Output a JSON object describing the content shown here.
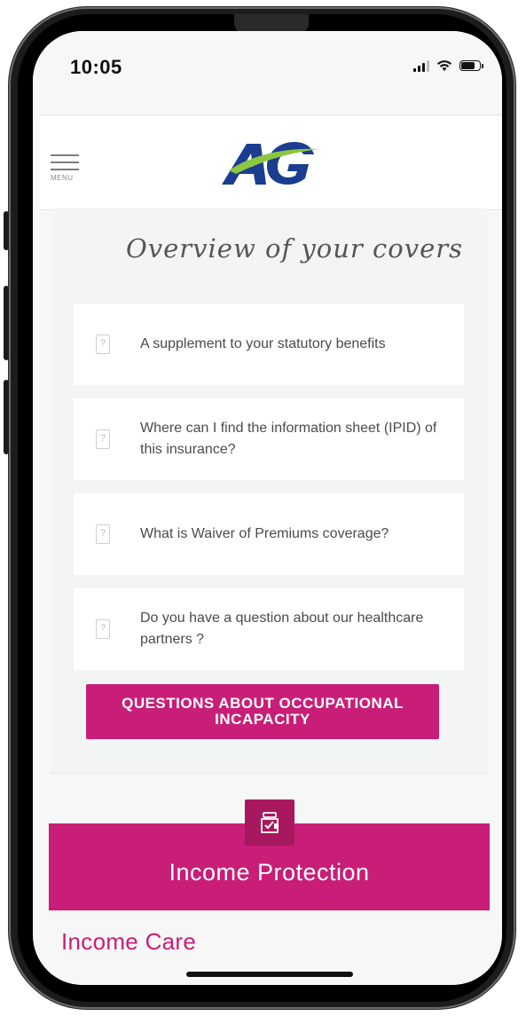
{
  "status_bar": {
    "time": "10:05"
  },
  "header": {
    "menu_label": "MENU",
    "logo_text": "AG"
  },
  "overview": {
    "title": "Overview of your covers"
  },
  "faq_items": [
    {
      "text": "A supplement to your statutory benefits"
    },
    {
      "text": "Where can I find the information sheet (IPID) of this insurance?"
    },
    {
      "text": "What is Waiver of Premiums coverage?"
    },
    {
      "text": "Do you have a question about our healthcare partners ?"
    }
  ],
  "occupational_button": {
    "label": "QUESTIONS ABOUT OCCUPATIONAL INCAPACITY"
  },
  "income_protection": {
    "title": "Income Protection",
    "icon": "policy-check-icon"
  },
  "income_care": {
    "label": "Income Care"
  },
  "colors": {
    "accent": "#c81e78",
    "accent_dark": "#a7185f",
    "brand_blue": "#1a3d8f",
    "brand_green": "#8dc63f"
  }
}
